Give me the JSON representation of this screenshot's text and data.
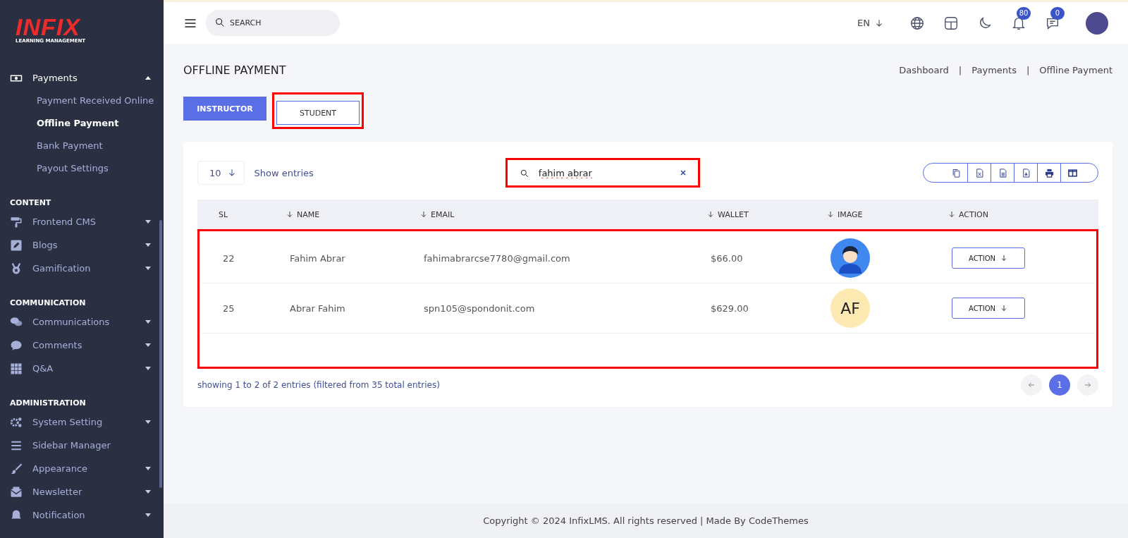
{
  "sidebar": {
    "logo": {
      "title": "INFIX",
      "subtitle": "LEARNING MANAGEMENT"
    },
    "sections": [
      {
        "items": [
          {
            "label": "Payments",
            "kind": "group",
            "expanded": true,
            "children": [
              {
                "label": "Payment Received Online",
                "selected": false
              },
              {
                "label": "Offline Payment",
                "selected": true
              },
              {
                "label": "Bank Payment",
                "selected": false
              },
              {
                "label": "Payout Settings",
                "selected": false
              }
            ]
          }
        ]
      },
      {
        "heading": "CONTENT",
        "items": [
          {
            "label": "Frontend CMS",
            "kind": "group",
            "expanded": false
          },
          {
            "label": "Blogs",
            "kind": "group",
            "expanded": false
          },
          {
            "label": "Gamification",
            "kind": "group",
            "expanded": false
          }
        ]
      },
      {
        "heading": "COMMUNICATION",
        "items": [
          {
            "label": "Communications",
            "kind": "group",
            "expanded": false
          },
          {
            "label": "Comments",
            "kind": "group",
            "expanded": false
          },
          {
            "label": "Q&A",
            "kind": "group",
            "expanded": false
          }
        ]
      },
      {
        "heading": "ADMINISTRATION",
        "items": [
          {
            "label": "System Setting",
            "kind": "group",
            "expanded": false
          },
          {
            "label": "Sidebar Manager",
            "kind": "link"
          },
          {
            "label": "Appearance",
            "kind": "group",
            "expanded": false
          },
          {
            "label": "Newsletter",
            "kind": "group",
            "expanded": false
          },
          {
            "label": "Notification",
            "kind": "group",
            "expanded": false
          }
        ]
      }
    ]
  },
  "topbar": {
    "search": {
      "placeholder": "SEARCH"
    },
    "language": "EN",
    "notification_count": "80",
    "message_count": "0"
  },
  "page": {
    "title": "OFFLINE PAYMENT",
    "breadcrumbs": [
      "Dashboard",
      "Payments",
      "Offline Payment"
    ],
    "breadcrumb_separator": "|"
  },
  "tabs": [
    {
      "label": "INSTRUCTOR",
      "selected": true,
      "highlighted": false
    },
    {
      "label": "STUDENT",
      "selected": false,
      "highlighted": true
    }
  ],
  "table": {
    "page_size": "10",
    "page_size_label": "Show entries",
    "search": {
      "value": "fahim abrar",
      "highlighted": true
    },
    "columns": [
      {
        "label": "SL",
        "sortable": false
      },
      {
        "label": "NAME",
        "sortable": true
      },
      {
        "label": "EMAIL",
        "sortable": true
      },
      {
        "label": "WALLET",
        "sortable": true
      },
      {
        "label": "IMAGE",
        "sortable": true
      },
      {
        "label": "ACTION",
        "sortable": true
      }
    ],
    "rows_highlighted": true,
    "rows": [
      {
        "sl": "22",
        "name": "Fahim Abrar",
        "email": "fahimabrarcse7780@gmail.com",
        "wallet": "$66.00",
        "image": {
          "kind": "avatar"
        },
        "action": "ACTION"
      },
      {
        "sl": "25",
        "name": "Abrar Fahim",
        "email": "spn105@spondonit.com",
        "wallet": "$629.00",
        "image": {
          "kind": "initials",
          "text": "AF"
        },
        "action": "ACTION"
      }
    ],
    "info": "showing 1 to 2 of 2 entries (filtered from 35 total entries)",
    "pages": [
      {
        "label": "1",
        "selected": true
      }
    ]
  },
  "footer": "Copyright © 2024 InfixLMS. All rights reserved | Made By CodeThemes"
}
